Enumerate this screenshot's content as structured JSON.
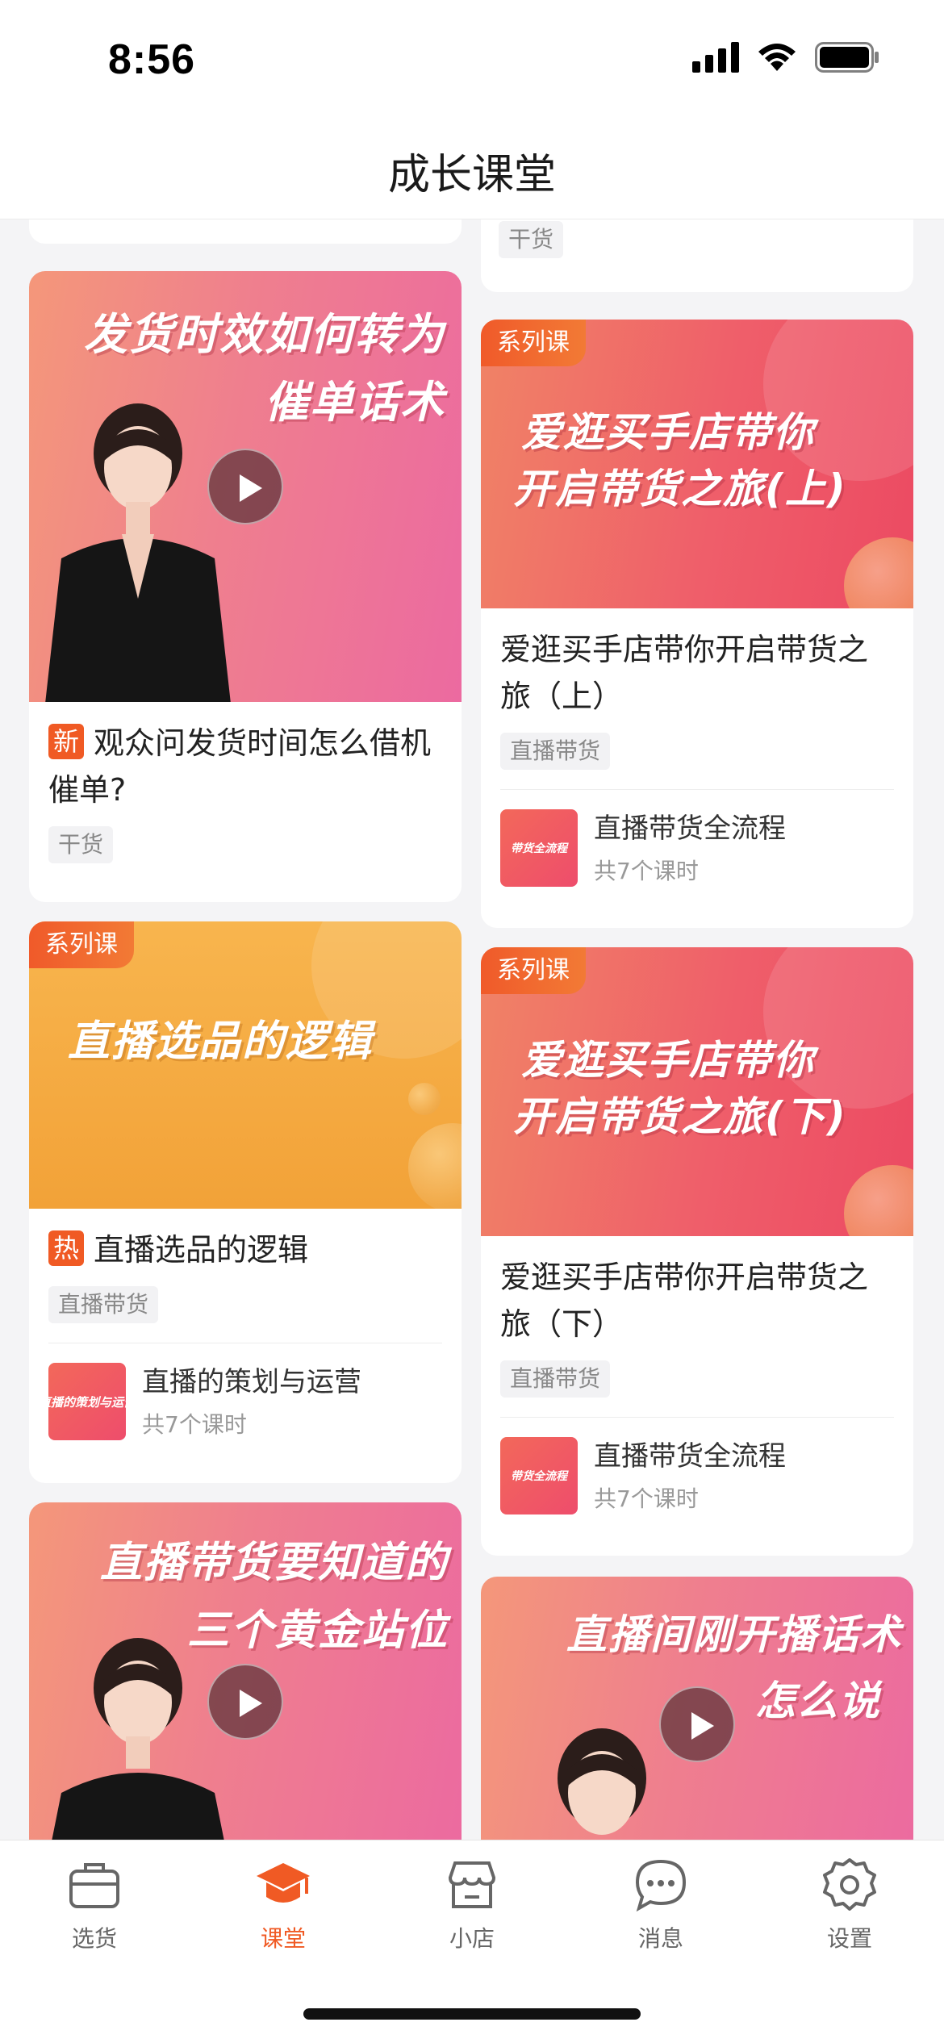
{
  "status_bar": {
    "time": "8:56"
  },
  "nav": {
    "title": "成长课堂"
  },
  "top_partial": {
    "tag": "干货"
  },
  "cards": {
    "left1": {
      "banner_line1": "发货时效如何转为",
      "banner_line2": "催单话术",
      "badge": "新",
      "title": "观众问发货时间怎么借机催单?",
      "tag": "干货"
    },
    "left2": {
      "series_tag": "系列课",
      "banner_line1": "直播选品的逻辑",
      "badge": "热",
      "title": "直播选品的逻辑",
      "tag": "直播带货",
      "course_thumb": "直播的策划与运营",
      "course_name": "直播的策划与运营",
      "course_count": "共7个课时"
    },
    "left3": {
      "banner_line1": "直播带货要知道的",
      "banner_line2": "三个黄金站位"
    },
    "right1": {
      "series_tag": "系列课",
      "banner_line1": "爱逛买手店带你",
      "banner_line2": "开启带货之旅(上)",
      "title": "爱逛买手店带你开启带货之旅（上）",
      "tag": "直播带货",
      "course_thumb": "带货全流程",
      "course_name": "直播带货全流程",
      "course_count": "共7个课时"
    },
    "right2": {
      "series_tag": "系列课",
      "banner_line1": "爱逛买手店带你",
      "banner_line2": "开启带货之旅(下)",
      "title": "爱逛买手店带你开启带货之旅（下）",
      "tag": "直播带货",
      "course_thumb": "带货全流程",
      "course_name": "直播带货全流程",
      "course_count": "共7个课时"
    },
    "right3": {
      "banner_line1": "直播间刚开播话术",
      "banner_line2": "怎么说"
    }
  },
  "tabs": [
    {
      "label": "选货",
      "icon": "shopping-bag-icon",
      "active": false
    },
    {
      "label": "课堂",
      "icon": "graduation-cap-icon",
      "active": true
    },
    {
      "label": "小店",
      "icon": "store-icon",
      "active": false
    },
    {
      "label": "消息",
      "icon": "chat-bubble-icon",
      "active": false
    },
    {
      "label": "设置",
      "icon": "gear-icon",
      "active": false
    }
  ],
  "colors": {
    "accent": "#f05a24",
    "background": "#f4f4f6"
  }
}
